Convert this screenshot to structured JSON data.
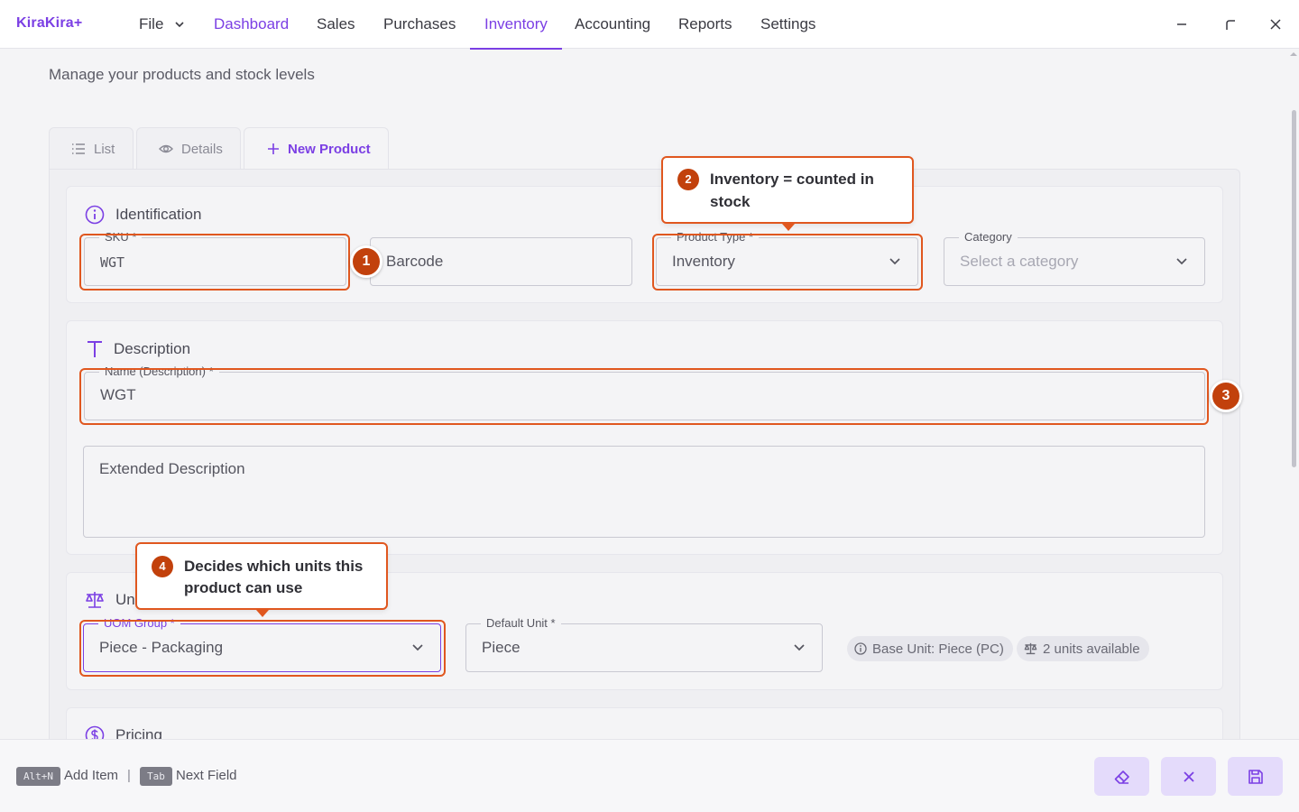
{
  "app": {
    "name": "KiraKira+"
  },
  "menu": {
    "file": "File",
    "items": [
      "Dashboard",
      "Sales",
      "Purchases",
      "Inventory",
      "Accounting",
      "Reports",
      "Settings"
    ],
    "active": "Inventory"
  },
  "window_controls": [
    "minimize-icon",
    "restore-icon",
    "close-icon"
  ],
  "page": {
    "subtitle": "Manage your products and stock levels"
  },
  "tabs": {
    "list": "List",
    "details": "Details",
    "new_product": "+ New Product",
    "new_product_label": "New Product"
  },
  "identification": {
    "title": "Identification",
    "sku": {
      "label": "SKU *",
      "value": "WGT"
    },
    "barcode": {
      "placeholder": "Barcode"
    },
    "product_type": {
      "label": "Product Type *",
      "value": "Inventory"
    },
    "category": {
      "label": "Category",
      "placeholder": "Select a category"
    }
  },
  "description": {
    "title": "Description",
    "name": {
      "label": "Name (Description) *",
      "value": "WGT"
    },
    "extended": {
      "placeholder": "Extended Description"
    }
  },
  "units": {
    "title": "Units",
    "title_visible": "Un",
    "uom_group": {
      "label": "UOM Group *",
      "value": "Piece - Packaging"
    },
    "default_unit": {
      "label": "Default Unit *",
      "value": "Piece"
    },
    "base_unit_chip": "Base Unit: Piece (PC)",
    "units_available_chip": "2 units available"
  },
  "pricing": {
    "title": "Pricing"
  },
  "callouts": {
    "c1": {
      "num": "1"
    },
    "c2": {
      "num": "2",
      "line1": "Inventory = counted in",
      "line2": "stock"
    },
    "c3": {
      "num": "3"
    },
    "c4": {
      "num": "4",
      "line1": "Decides which units this",
      "line2": "product can use"
    }
  },
  "footer": {
    "shortcut1_key": "Alt+N",
    "shortcut1_label": "Add Item",
    "separator": "|",
    "shortcut2_key": "Tab",
    "shortcut2_label": "Next Field",
    "buttons": [
      "eraser-icon",
      "close-icon",
      "save-icon"
    ]
  },
  "colors": {
    "accent": "#7b3fe4",
    "highlight": "#e0571f",
    "badge": "#c2410c"
  }
}
